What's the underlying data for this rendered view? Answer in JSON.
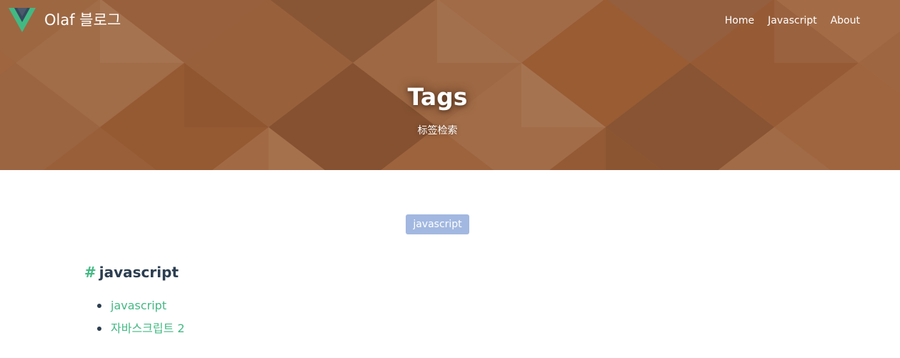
{
  "header": {
    "brand_name": "Olaf 블로그",
    "logo_icon": "vue-logo-icon",
    "nav": [
      {
        "label": "Home"
      },
      {
        "label": "Javascript"
      },
      {
        "label": "About"
      }
    ]
  },
  "hero": {
    "title": "Tags",
    "subtitle": "标签检索"
  },
  "tag_cloud": {
    "tags": [
      {
        "label": "javascript"
      }
    ]
  },
  "tag_section": {
    "hash": "#",
    "heading": "javascript",
    "posts": [
      {
        "title": "javascript"
      },
      {
        "title": "자바스크립트 2"
      }
    ]
  },
  "colors": {
    "hero_base": "#a3683f",
    "accent_green": "#42b983",
    "text_dark": "#2c3e50",
    "tag_pill": "#a2b8e0"
  }
}
